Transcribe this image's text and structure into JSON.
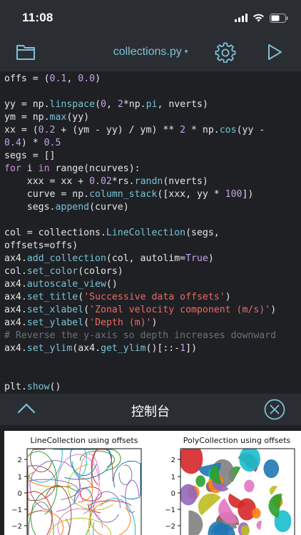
{
  "status_bar": {
    "time": "11:08"
  },
  "toolbar": {
    "folder_icon": "folder-icon",
    "title": "collections.py",
    "title_caret": "▾",
    "settings_icon": "gear-icon",
    "run_icon": "play-icon"
  },
  "editor": {
    "lines": [
      {
        "text": "offs = (0.1, 0.0)"
      },
      {
        "text": ""
      },
      {
        "text": "yy = np.linspace(0, 2*np.pi, nverts)"
      },
      {
        "text": "ym = np.max(yy)"
      },
      {
        "text": "xx = (0.2 + (ym - yy) / ym) ** 2 * np.cos(yy -"
      },
      {
        "text": "0.4) * 0.5"
      },
      {
        "text": "segs = []"
      },
      {
        "text": "for i in range(ncurves):"
      },
      {
        "text": "    xxx = xx + 0.02*rs.randn(nverts)"
      },
      {
        "text": "    curve = np.column_stack([xxx, yy * 100])"
      },
      {
        "text": "    segs.append(curve)"
      },
      {
        "text": ""
      },
      {
        "text": "col = collections.LineCollection(segs,"
      },
      {
        "text": "offsets=offs)"
      },
      {
        "text": "ax4.add_collection(col, autolim=True)"
      },
      {
        "text": "col.set_color(colors)"
      },
      {
        "text": "ax4.autoscale_view()"
      },
      {
        "text": "ax4.set_title('Successive data offsets')"
      },
      {
        "text": "ax4.set_xlabel('Zonal velocity component (m/s)')"
      },
      {
        "text": "ax4.set_ylabel('Depth (m)')"
      },
      {
        "text": "# Reverse the y-axis so depth increases downward"
      },
      {
        "text": "ax4.set_ylim(ax4.get_ylim()[::-1])"
      },
      {
        "text": ""
      },
      {
        "text": ""
      },
      {
        "text": "plt.show()"
      }
    ]
  },
  "console": {
    "title": "控制台",
    "collapse_icon": "chevron-up-icon",
    "close_icon": "close-circle-icon"
  },
  "chart_data": [
    {
      "type": "line",
      "title": "LineCollection using offsets",
      "y_tick_labels": [
        "2",
        "1",
        "0",
        "−1",
        "−2"
      ],
      "ylim": [
        -2.5,
        2.5
      ]
    },
    {
      "type": "scatter",
      "title": "PolyCollection using offsets",
      "y_tick_labels": [
        "2",
        "1",
        "0",
        "−1",
        "−2"
      ],
      "ylim": [
        -2.5,
        2.5
      ]
    }
  ]
}
